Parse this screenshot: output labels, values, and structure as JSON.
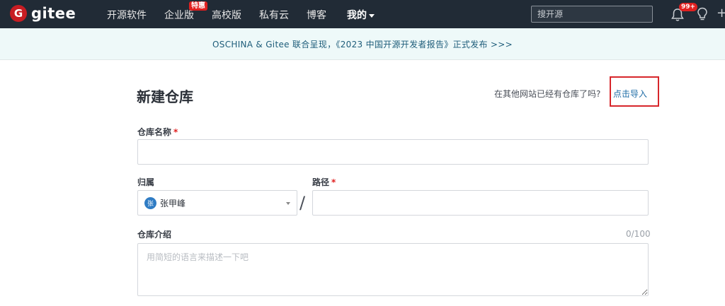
{
  "nav": {
    "logo_letter": "G",
    "logo_text": "gitee",
    "items": [
      "开源软件",
      "企业版",
      "高校版",
      "私有云",
      "博客"
    ],
    "mine_label": "我的",
    "promo_badge": "特惠",
    "search_placeholder": "搜开源",
    "notification_count": "99+",
    "plus_symbol": "+"
  },
  "banner": {
    "text": "OSCHINA & Gitee 联合呈现，《2023 中国开源开发者报告》正式发布 >>>"
  },
  "form": {
    "title": "新建仓库",
    "import_hint": "在其他网站已经有仓库了吗?",
    "import_link": "点击导入",
    "repo_name_label": "仓库名称",
    "required_mark": "*",
    "owner_label": "归属",
    "owner_avatar": "张",
    "owner_name": "张甲峰",
    "path_label": "路径",
    "slash": "/",
    "desc_label": "仓库介绍",
    "desc_counter": "0/100",
    "desc_placeholder": "用简短的语言来描述一下吧"
  },
  "colors": {
    "nav_bg": "#212b36",
    "brand_red": "#c71d23",
    "banner_bg": "#eef9f9",
    "link": "#1e6ca6",
    "highlight": "#d7262b"
  }
}
